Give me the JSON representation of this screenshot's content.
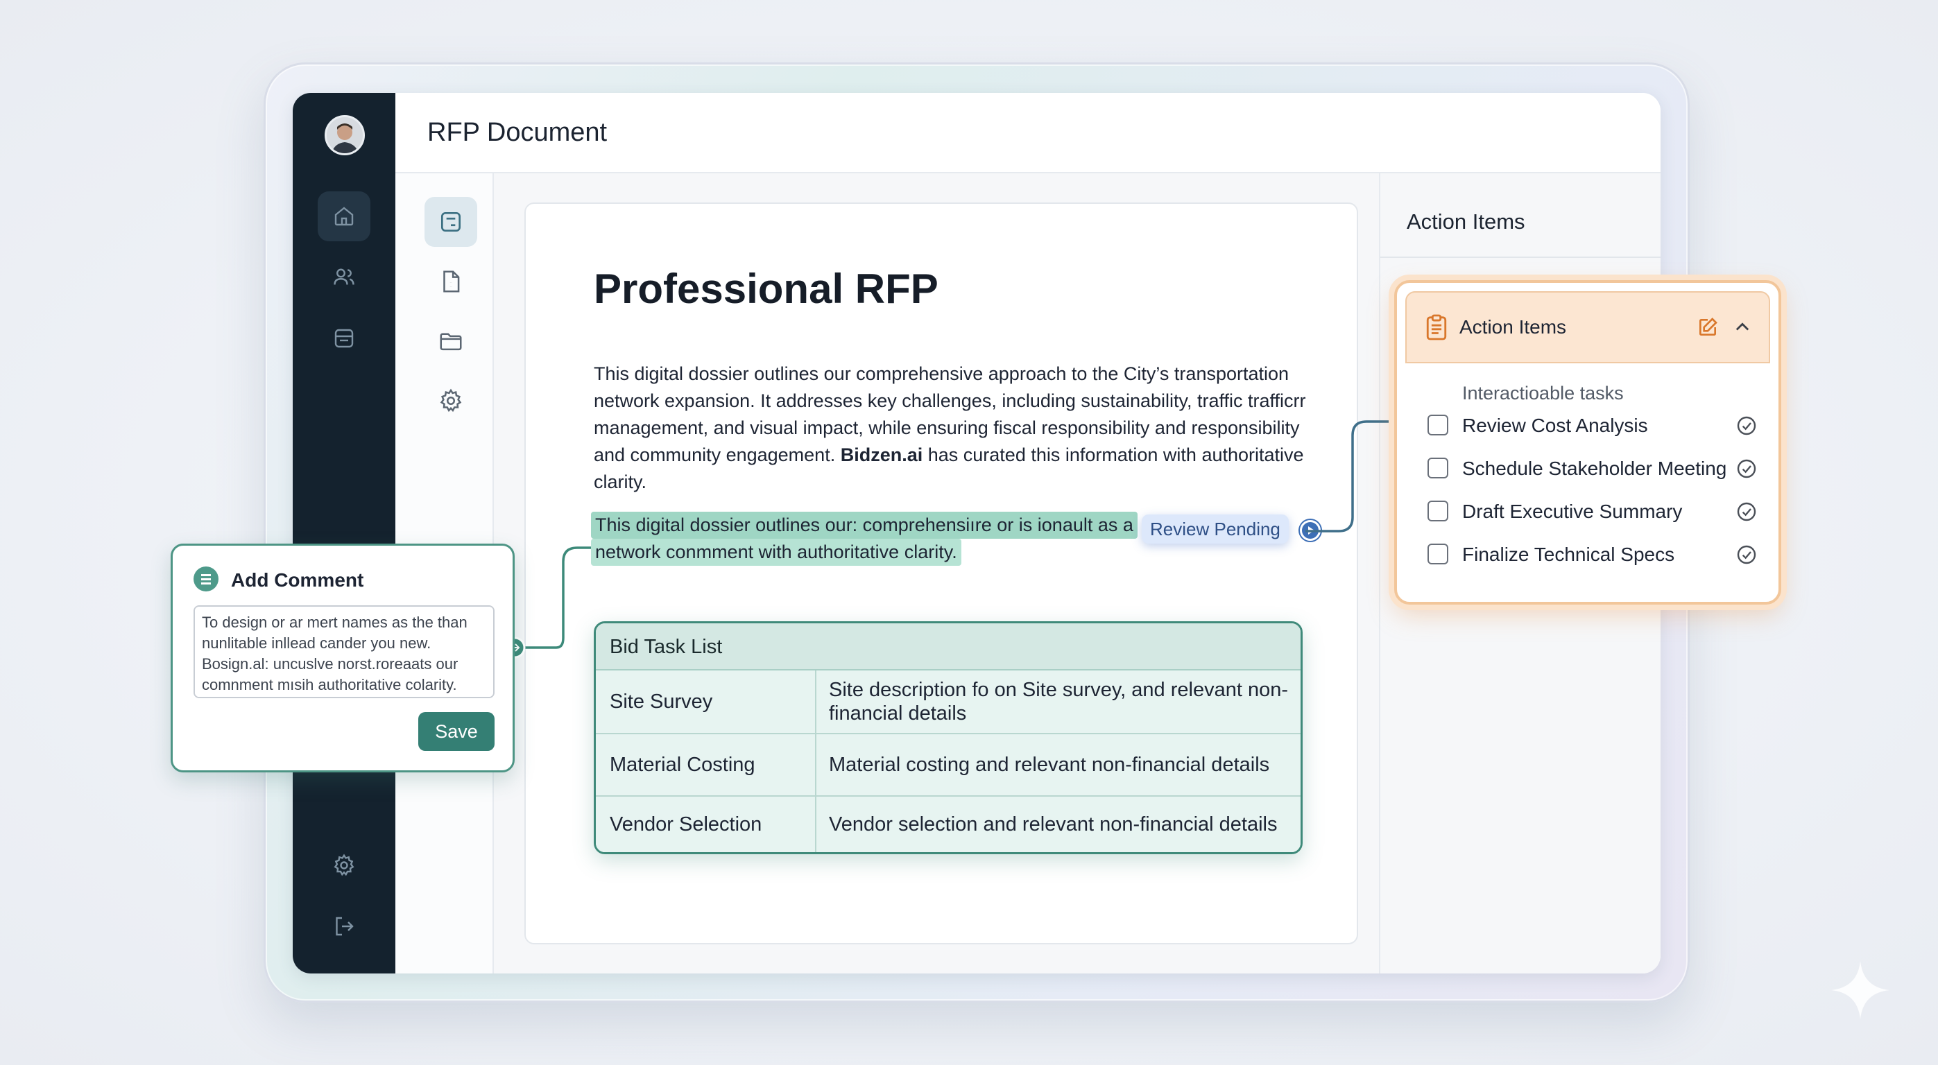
{
  "header": {
    "title": "RFP Document"
  },
  "document": {
    "title": "Professional RFP",
    "paragraph_parts": [
      "This digital dossier outlines our comprehensive approach to the City’s transportation network expansion. It addresses key challenges, including sustainability, traffic trafficrr management, and visual impact, while ensuring fiscal responsibility and responsibility and community engagement. ",
      "Bidzen.ai",
      " has curated this information with authoritative clarity."
    ],
    "highlight_lines": [
      "This digital dossier outlines our: comprehensiıre or is ionault as a",
      "network conmment with authoritative clarity."
    ],
    "review_badge": "Review Pending"
  },
  "bid_table": {
    "title": "Bid Task List",
    "rows": [
      {
        "task": "Site Survey",
        "details": "Site description fo on Site survey, and relevant non-financial details"
      },
      {
        "task": "Material Costing",
        "details": "Material costing and relevant non-financial details"
      },
      {
        "task": "Vendor Selection",
        "details": "Vendor selection and relevant non-financial details"
      }
    ]
  },
  "action_panel": {
    "title": "Action Items"
  },
  "action_card": {
    "title": "Action Items",
    "subtitle": "Interactioable tasks",
    "items": [
      {
        "label": "Review Cost Analysis"
      },
      {
        "label": "Schedule Stakeholder Meeting"
      },
      {
        "label": "Draft Executive Summary"
      },
      {
        "label": "Finalize Technical Specs"
      }
    ]
  },
  "comment": {
    "title": "Add Comment",
    "text": "To design or ar mert names as the than nunlitable inllead cander you new. Bosign.al: uncuslve norst.roreaats our comnment mısih authoritative colarity.",
    "save_label": "Save"
  },
  "colors": {
    "rail": "#14222e",
    "accent_teal": "#347f74",
    "highlight": "#9fd6c4",
    "action_orange": "#f2c69a",
    "review_blue": "#3d6fb6"
  },
  "icons": {
    "rail": [
      "home-icon",
      "users-icon",
      "archive-icon",
      "settings-icon",
      "logout-icon"
    ],
    "sidebar": [
      "canvas-icon",
      "document-icon",
      "folder-icon",
      "gear-icon"
    ]
  }
}
